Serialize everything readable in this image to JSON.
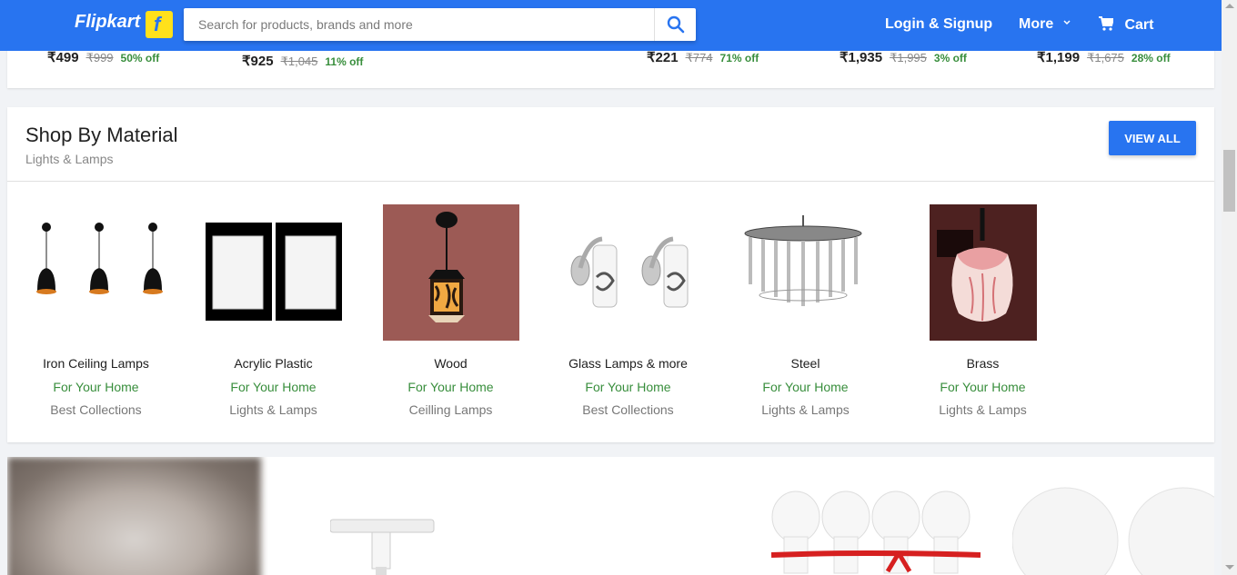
{
  "header": {
    "logo_text": "Flipkart",
    "search_placeholder": "Search for products, brands and more",
    "login_label": "Login & Signup",
    "more_label": "More",
    "cart_label": "Cart",
    "brand_color": "#2874f0"
  },
  "top_strip": {
    "prices": [
      {
        "now": "₹499",
        "old": "₹999",
        "off": "50% off"
      },
      {
        "now": "₹925",
        "old": "₹1,045",
        "off": "11% off"
      },
      {
        "now": "₹221",
        "old": "₹774",
        "off": "71% off"
      },
      {
        "now": "₹1,935",
        "old": "₹1,995",
        "off": "3% off"
      },
      {
        "now": "₹1,199",
        "old": "₹1,675",
        "off": "28% off"
      }
    ]
  },
  "shop_by_material": {
    "title": "Shop By Material",
    "subtitle": "Lights & Lamps",
    "view_all_label": "VIEW ALL",
    "items": [
      {
        "name": "Iron Ceiling Lamps",
        "tag": "For Your Home",
        "category": "Best Collections"
      },
      {
        "name": "Acrylic Plastic",
        "tag": "For Your Home",
        "category": "Lights & Lamps"
      },
      {
        "name": "Wood",
        "tag": "For Your Home",
        "category": "Ceilling Lamps"
      },
      {
        "name": "Glass Lamps & more",
        "tag": "For Your Home",
        "category": "Best Collections"
      },
      {
        "name": "Steel",
        "tag": "For Your Home",
        "category": "Lights & Lamps"
      },
      {
        "name": "Brass",
        "tag": "For Your Home",
        "category": "Lights & Lamps"
      }
    ]
  },
  "icons": {
    "search": "search-icon",
    "cart": "cart-icon",
    "more_chevron": "chevron-down-icon"
  }
}
